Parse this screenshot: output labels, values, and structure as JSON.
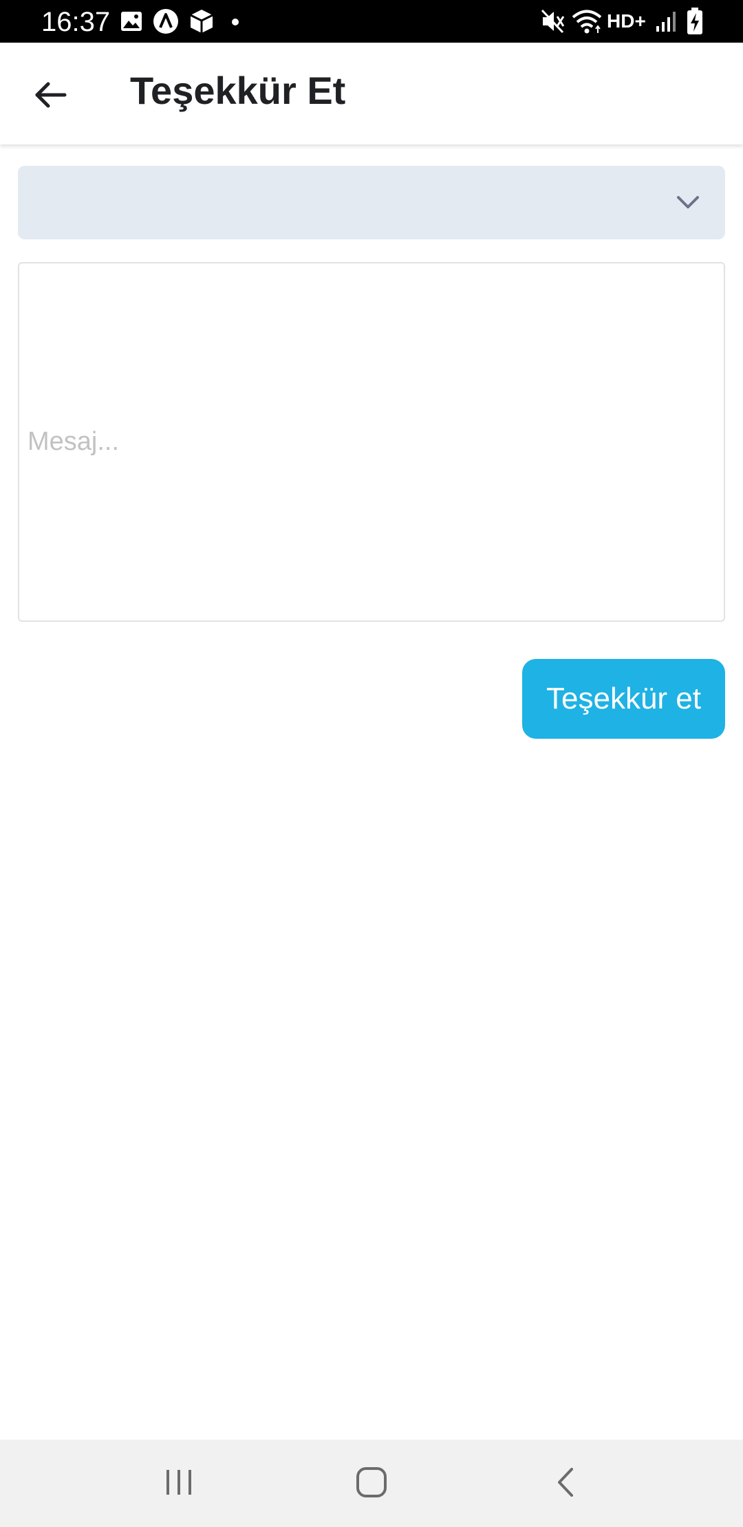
{
  "status_bar": {
    "time": "16:37",
    "network_label": "HD+",
    "icons": [
      "gallery-icon",
      "app-a-icon",
      "package-icon",
      "notification-dot-icon",
      "mute-icon",
      "wifi-icon",
      "signal-icon",
      "battery-charging-icon"
    ]
  },
  "app_bar": {
    "title": "Teşekkür Et",
    "back_icon": "arrow-left-icon"
  },
  "form": {
    "dropdown_value": "",
    "dropdown_icon": "chevron-down-icon",
    "message_value": "",
    "message_placeholder": "Mesaj...",
    "submit_label": "Teşekkür et"
  },
  "nav_bar": {
    "icons": [
      "recent-apps-icon",
      "home-icon",
      "back-icon"
    ]
  },
  "colors": {
    "status_bar_bg": "#000000",
    "dropdown_bg": "#e3eaf2",
    "button_bg": "#1fb2e4",
    "nav_bar_bg": "#f1f1f1",
    "title_text": "#202124"
  }
}
